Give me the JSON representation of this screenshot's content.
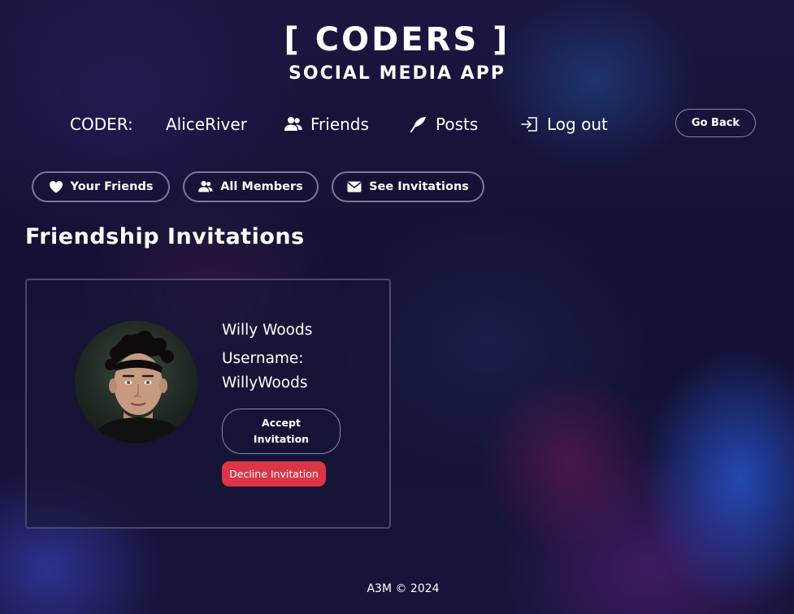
{
  "brand": {
    "title": "[ CODERS ]",
    "subtitle": "SOCIAL MEDIA APP"
  },
  "topnav": {
    "coder_label": "CODER:",
    "coder_name": "AliceRiver",
    "friends": {
      "label": "Friends",
      "icon": "users-icon"
    },
    "posts": {
      "label": "Posts",
      "icon": "feather-icon"
    },
    "logout": {
      "label": "Log out",
      "icon": "logout-icon"
    },
    "go_back": "Go Back"
  },
  "subnav": [
    {
      "label": "Your Friends",
      "icon": "heart-icon"
    },
    {
      "label": "All Members",
      "icon": "users-icon"
    },
    {
      "label": "See Invitations",
      "icon": "envelope-icon"
    }
  ],
  "section_title": "Friendship Invitations",
  "invitation": {
    "name": "Willy Woods",
    "username_label": "Username:",
    "username": "WillyWoods",
    "accept_label": "Accept Invitation",
    "decline_label": "Decline Invitation"
  },
  "footer": "A3M © 2024",
  "colors": {
    "background": "#131033",
    "decline": "#dc3545",
    "border": "#7a7a93"
  }
}
